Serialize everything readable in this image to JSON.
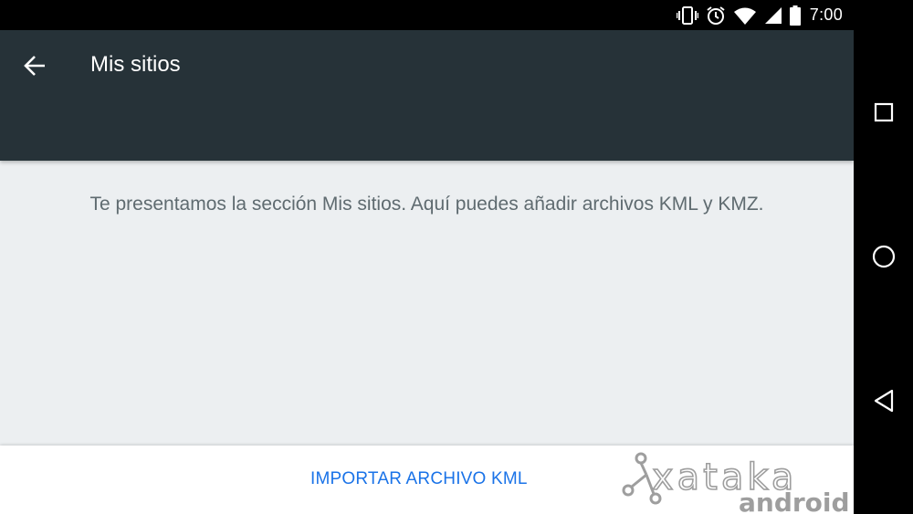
{
  "status_bar": {
    "time": "7:00",
    "icons": [
      "vibrate-icon",
      "alarm-icon",
      "wifi-icon",
      "cell-signal-icon",
      "battery-icon"
    ]
  },
  "toolbar": {
    "title": "Mis sitios",
    "back_icon": "arrow-back-icon",
    "background": "#263238"
  },
  "content": {
    "message": "Te presentamos la sección Mis sitios. Aquí puedes añadir archivos KML y KMZ.",
    "background": "#eceff1"
  },
  "bottom_bar": {
    "import_label": "IMPORTAR ARCHIVO KML",
    "accent": "#1a73e8"
  },
  "watermark": {
    "line1": "xataka",
    "line2": "android"
  },
  "nav_bar": {
    "buttons": [
      "recents-icon",
      "home-icon",
      "back-triangle-icon"
    ]
  }
}
